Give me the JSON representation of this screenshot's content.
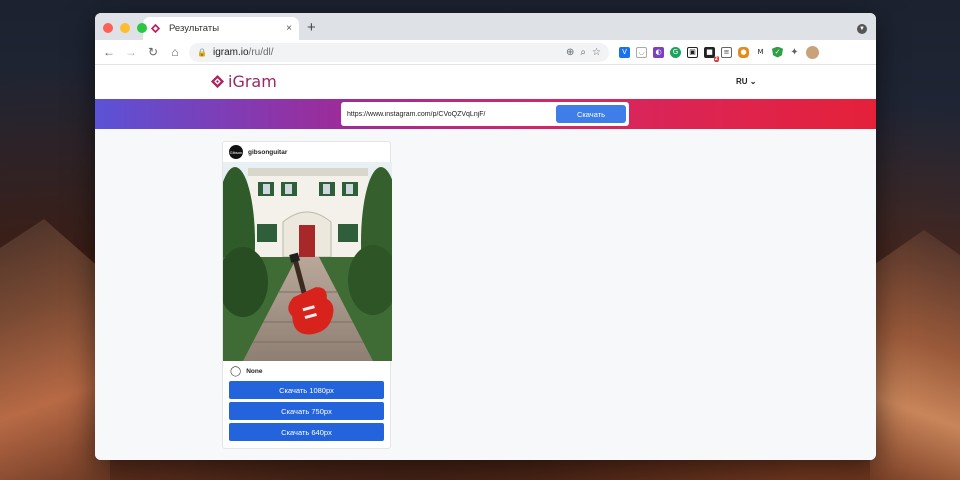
{
  "browser": {
    "tab_title": "Результаты",
    "tab_close": "×",
    "new_tab": "+",
    "url_host": "igram.io",
    "url_path": "/ru/dl/",
    "nav": {
      "back": "←",
      "forward": "→",
      "reload": "↻",
      "home": "⌂"
    }
  },
  "site": {
    "logo_text": "iGram",
    "language": "RU",
    "brand_color": "#9b2766"
  },
  "search": {
    "value": "https://www.instagram.com/p/CVoQZVqLnjF/",
    "button_label": "Скачать"
  },
  "post": {
    "username": "gibsonguitar",
    "avatar_text": "Gibson",
    "caption": "None",
    "buttons": [
      {
        "label": "Скачать 1080px"
      },
      {
        "label": "Скачать 750px"
      },
      {
        "label": "Скачать 640px"
      }
    ]
  },
  "extensions": {
    "badge_count": "2"
  }
}
